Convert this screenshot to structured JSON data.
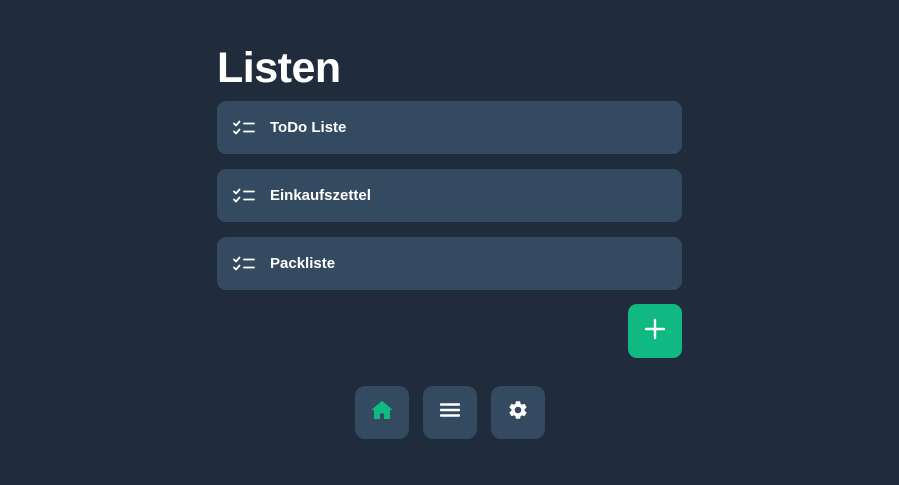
{
  "page": {
    "title": "Listen"
  },
  "lists": [
    {
      "label": "ToDo Liste",
      "icon": "checklist-icon"
    },
    {
      "label": "Einkaufszettel",
      "icon": "checklist-icon"
    },
    {
      "label": "Packliste",
      "icon": "checklist-icon"
    }
  ],
  "add_button": {
    "icon": "plus-icon"
  },
  "nav": {
    "items": [
      {
        "name": "home",
        "icon": "home-icon",
        "active": true
      },
      {
        "name": "menu",
        "icon": "menu-icon",
        "active": false
      },
      {
        "name": "settings",
        "icon": "gear-icon",
        "active": false
      }
    ]
  },
  "colors": {
    "background": "#202c3b",
    "card": "#344a61",
    "accent": "#10b981",
    "text": "#ffffff"
  }
}
